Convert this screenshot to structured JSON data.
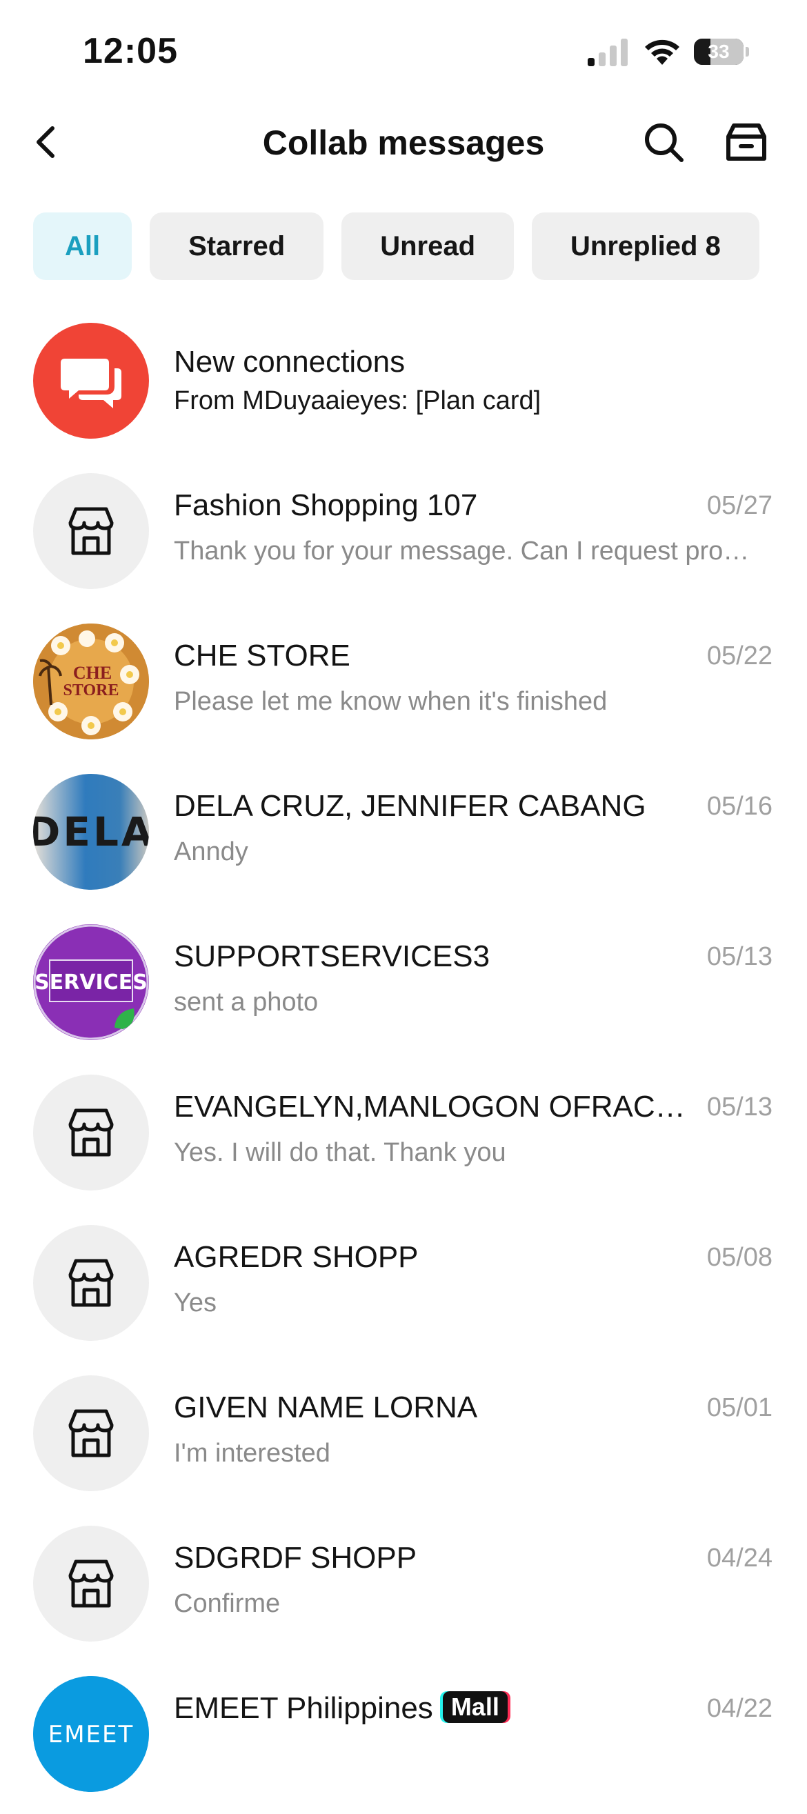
{
  "status_bar": {
    "time": "12:05",
    "battery": "33"
  },
  "header": {
    "title": "Collab messages"
  },
  "filters": [
    {
      "label": "All",
      "active": true
    },
    {
      "label": "Starred",
      "active": false
    },
    {
      "label": "Unread",
      "active": false
    },
    {
      "label": "Unreplied 8",
      "active": false
    }
  ],
  "new_connections": {
    "title": "New connections",
    "preview": "From MDuyaaieyes: [Plan card]",
    "icon": "chat-bubbles-icon",
    "color": "#f04436"
  },
  "conversations": [
    {
      "name": "Fashion Shopping 107",
      "preview": "Thank you for your message. Can I request product samples for creating content? Thank you",
      "date": "05/27",
      "avatar": "store-icon"
    },
    {
      "name": "CHE STORE",
      "preview": "Please let me know when it's finished",
      "date": "05/22",
      "avatar": "che-store-logo",
      "avatar_text": [
        "CHE",
        "STORE"
      ]
    },
    {
      "name": "DELA CRUZ, JENNIFER CABANG",
      "preview": "Anndy",
      "date": "05/16",
      "avatar": "dela-logo",
      "avatar_text": "DELA"
    },
    {
      "name": "SUPPORTSERVICES3",
      "preview": "sent a photo",
      "date": "05/13",
      "avatar": "services-logo",
      "avatar_text": "SERVICES"
    },
    {
      "name": "EVANGELYN,MANLOGON OFRACIO SHOPP",
      "preview": "Yes. I will do that. Thank you",
      "date": "05/13",
      "avatar": "store-icon"
    },
    {
      "name": "AGREDR SHOPP",
      "preview": "Yes",
      "date": "05/08",
      "avatar": "store-icon"
    },
    {
      "name": "GIVEN NAME LORNA",
      "preview": "I'm interested",
      "date": "05/01",
      "avatar": "store-icon"
    },
    {
      "name": "SDGRDF SHOPP",
      "preview": "Confirme",
      "date": "04/24",
      "avatar": "store-icon"
    },
    {
      "name": "EMEET Philippines",
      "badge": "Mall",
      "preview": "",
      "date": "04/22",
      "avatar": "emeet-logo",
      "avatar_text": "EMEET"
    }
  ]
}
